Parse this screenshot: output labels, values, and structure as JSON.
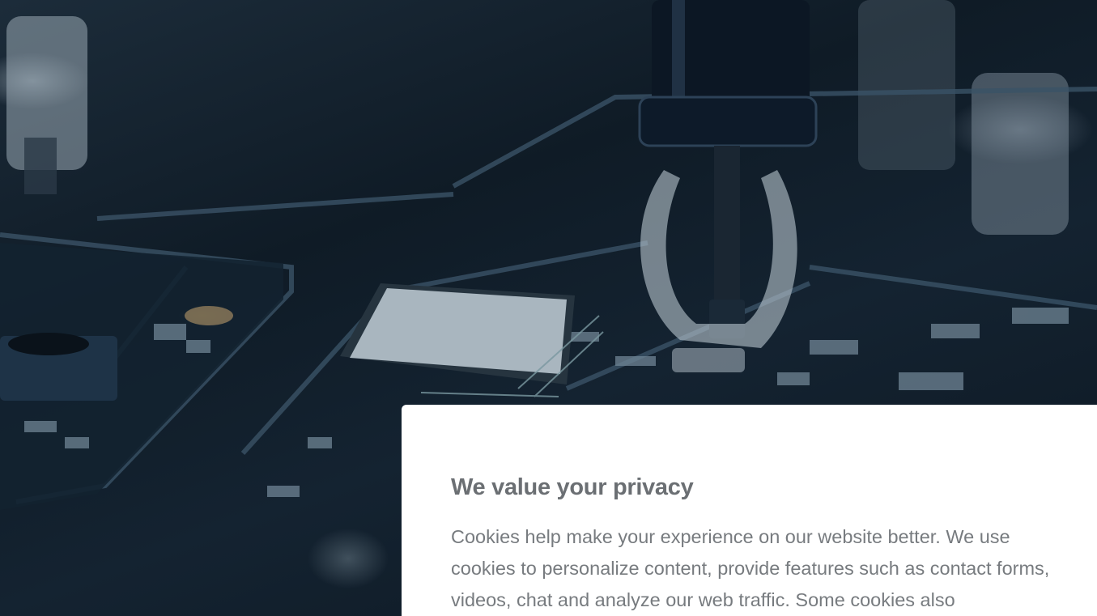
{
  "background": {
    "image_subject": "circuit-board-with-robotic-pick-and-place-arm",
    "tint_color": "#0f1b26"
  },
  "cookie_banner": {
    "title": "We value your privacy",
    "body": "Cookies help make your experience on our website better. We use cookies to personalize content, provide features such as contact forms, videos, chat and analyze our web traffic. Some cookies also",
    "background_color": "#ffffff",
    "title_color": "#6b6f73",
    "text_color": "#777b7f"
  }
}
